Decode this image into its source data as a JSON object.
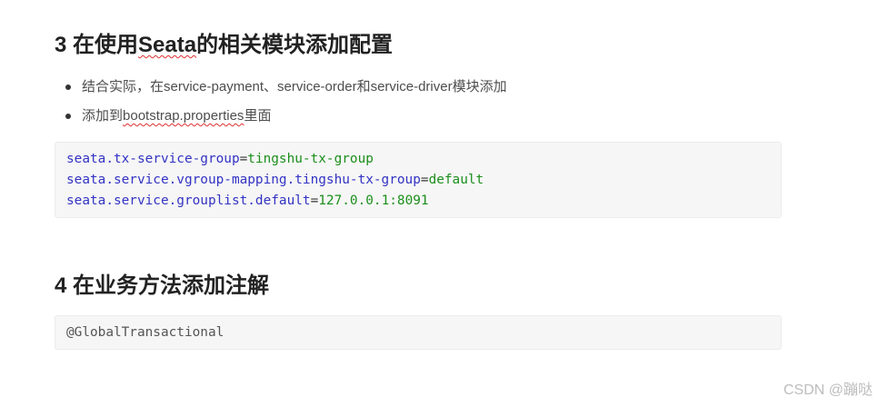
{
  "section_3": {
    "heading": {
      "prefix": "3 在使用",
      "flagged": "Seata",
      "suffix": "的相关模块添加配置"
    },
    "bullets": [
      {
        "text": "结合实际，在service-payment、service-order和service-driver模块添加"
      },
      {
        "prefix": "添加到",
        "flagged": "bootstrap.properties",
        "suffix": "里面"
      }
    ],
    "code": [
      {
        "key": "seata.tx-service-group",
        "op": "=",
        "value": "tingshu-tx-group"
      },
      {
        "key": "seata.service.vgroup-mapping.tingshu-tx-group",
        "op": "=",
        "value": "default"
      },
      {
        "key": "seata.service.grouplist.default",
        "op": "=",
        "value": "127.0.0.1:8091"
      }
    ]
  },
  "section_4": {
    "heading": "4 在业务方法添加注解",
    "code": "@GlobalTransactional"
  },
  "watermark": "CSDN @蹦哒",
  "colors": {
    "heading": "#222222",
    "body_text": "#4d4d4d",
    "bullet": "#333333",
    "code_key": "#3333c4",
    "code_operator": "#333333",
    "code_value": "#1c8f1c",
    "code_plain": "#555555",
    "code_bg": "#f6f6f6",
    "code_border": "#ececec",
    "spellcheck_underline": "#e03030",
    "watermark": "#bdbdbd"
  }
}
